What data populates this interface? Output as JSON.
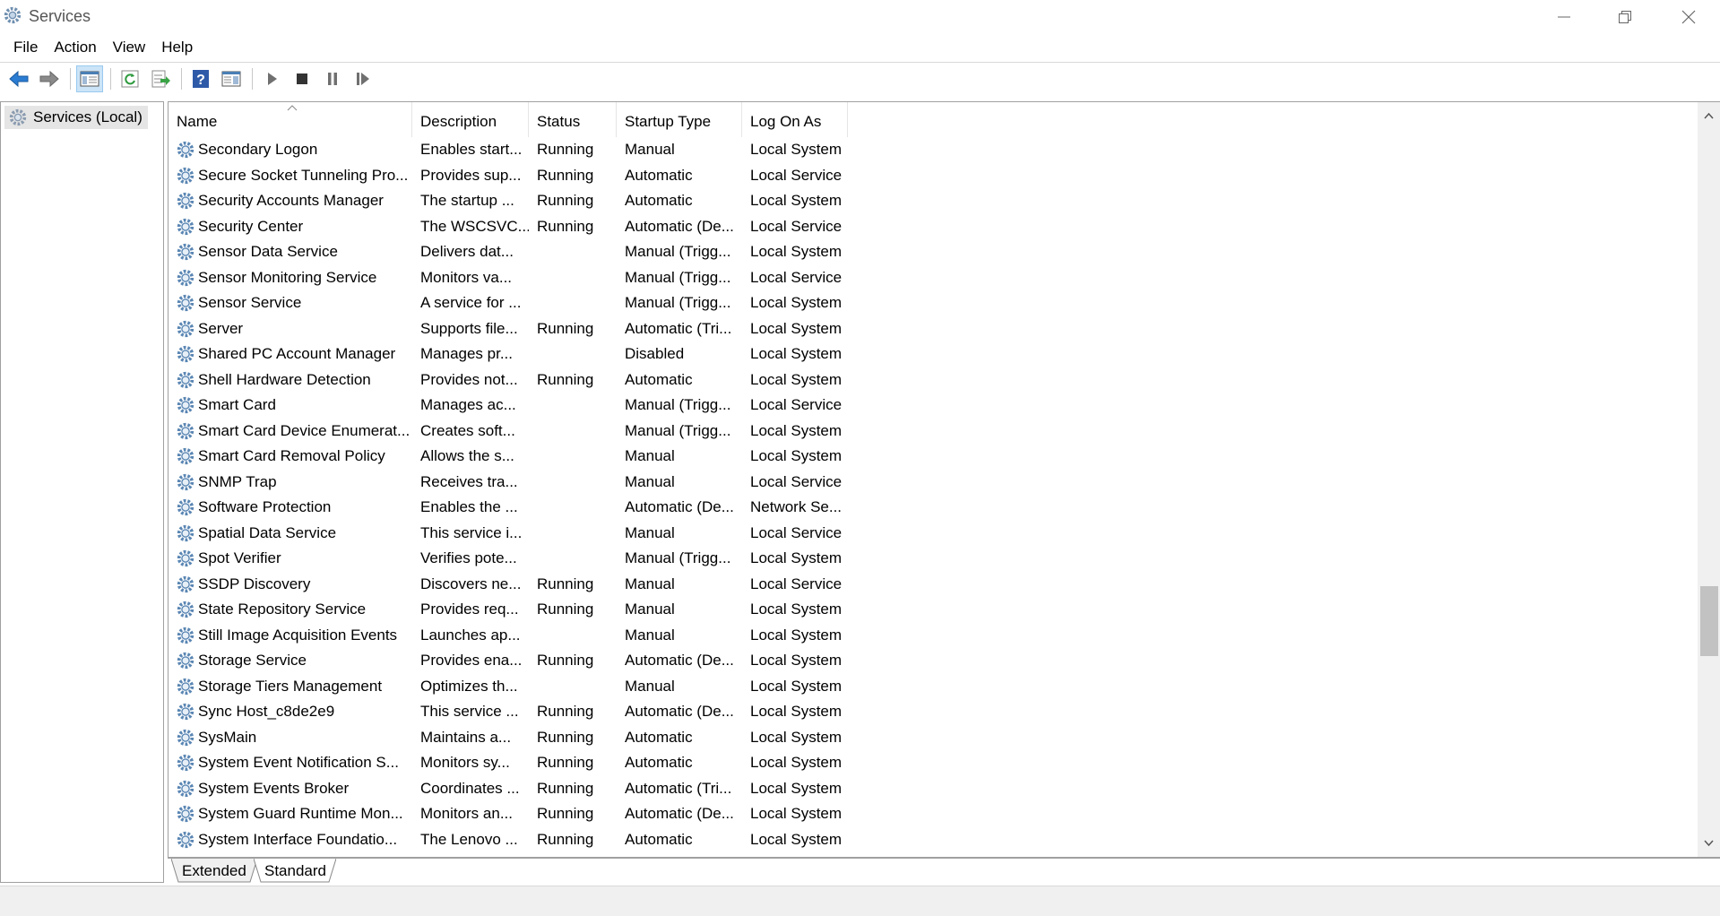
{
  "window": {
    "title": "Services"
  },
  "menu": [
    "File",
    "Action",
    "View",
    "Help"
  ],
  "tree": {
    "root": "Services (Local)"
  },
  "columns": [
    "Name",
    "Description",
    "Status",
    "Startup Type",
    "Log On As"
  ],
  "rows": [
    [
      "Secondary Logon",
      "Enables start...",
      "Running",
      "Manual",
      "Local System"
    ],
    [
      "Secure Socket Tunneling Pro...",
      "Provides sup...",
      "Running",
      "Automatic",
      "Local Service"
    ],
    [
      "Security Accounts Manager",
      "The startup ...",
      "Running",
      "Automatic",
      "Local System"
    ],
    [
      "Security Center",
      "The WSCSVC...",
      "Running",
      "Automatic (De...",
      "Local Service"
    ],
    [
      "Sensor Data Service",
      "Delivers dat...",
      "",
      "Manual (Trigg...",
      "Local System"
    ],
    [
      "Sensor Monitoring Service",
      "Monitors va...",
      "",
      "Manual (Trigg...",
      "Local Service"
    ],
    [
      "Sensor Service",
      "A service for ...",
      "",
      "Manual (Trigg...",
      "Local System"
    ],
    [
      "Server",
      "Supports file...",
      "Running",
      "Automatic (Tri...",
      "Local System"
    ],
    [
      "Shared PC Account Manager",
      "Manages pr...",
      "",
      "Disabled",
      "Local System"
    ],
    [
      "Shell Hardware Detection",
      "Provides not...",
      "Running",
      "Automatic",
      "Local System"
    ],
    [
      "Smart Card",
      "Manages ac...",
      "",
      "Manual (Trigg...",
      "Local Service"
    ],
    [
      "Smart Card Device Enumerat...",
      "Creates soft...",
      "",
      "Manual (Trigg...",
      "Local System"
    ],
    [
      "Smart Card Removal Policy",
      "Allows the s...",
      "",
      "Manual",
      "Local System"
    ],
    [
      "SNMP Trap",
      "Receives tra...",
      "",
      "Manual",
      "Local Service"
    ],
    [
      "Software Protection",
      "Enables the ...",
      "",
      "Automatic (De...",
      "Network Se..."
    ],
    [
      "Spatial Data Service",
      "This service i...",
      "",
      "Manual",
      "Local Service"
    ],
    [
      "Spot Verifier",
      "Verifies pote...",
      "",
      "Manual (Trigg...",
      "Local System"
    ],
    [
      "SSDP Discovery",
      "Discovers ne...",
      "Running",
      "Manual",
      "Local Service"
    ],
    [
      "State Repository Service",
      "Provides req...",
      "Running",
      "Manual",
      "Local System"
    ],
    [
      "Still Image Acquisition Events",
      "Launches ap...",
      "",
      "Manual",
      "Local System"
    ],
    [
      "Storage Service",
      "Provides ena...",
      "Running",
      "Automatic (De...",
      "Local System"
    ],
    [
      "Storage Tiers Management",
      "Optimizes th...",
      "",
      "Manual",
      "Local System"
    ],
    [
      "Sync Host_c8de2e9",
      "This service ...",
      "Running",
      "Automatic (De...",
      "Local System"
    ],
    [
      "SysMain",
      "Maintains a...",
      "Running",
      "Automatic",
      "Local System"
    ],
    [
      "System Event Notification S...",
      "Monitors sy...",
      "Running",
      "Automatic",
      "Local System"
    ],
    [
      "System Events Broker",
      "Coordinates ...",
      "Running",
      "Automatic (Tri...",
      "Local System"
    ],
    [
      "System Guard Runtime Mon...",
      "Monitors an...",
      "Running",
      "Automatic (De...",
      "Local System"
    ],
    [
      "System Interface Foundatio...",
      "The Lenovo ...",
      "Running",
      "Automatic",
      "Local System"
    ]
  ],
  "tabs": [
    "Extended",
    "Standard"
  ],
  "active_tab": "Standard",
  "colors": {
    "selection": "#cce4f7",
    "border": "#a0a0a0",
    "gear": "#4a7fb5"
  }
}
